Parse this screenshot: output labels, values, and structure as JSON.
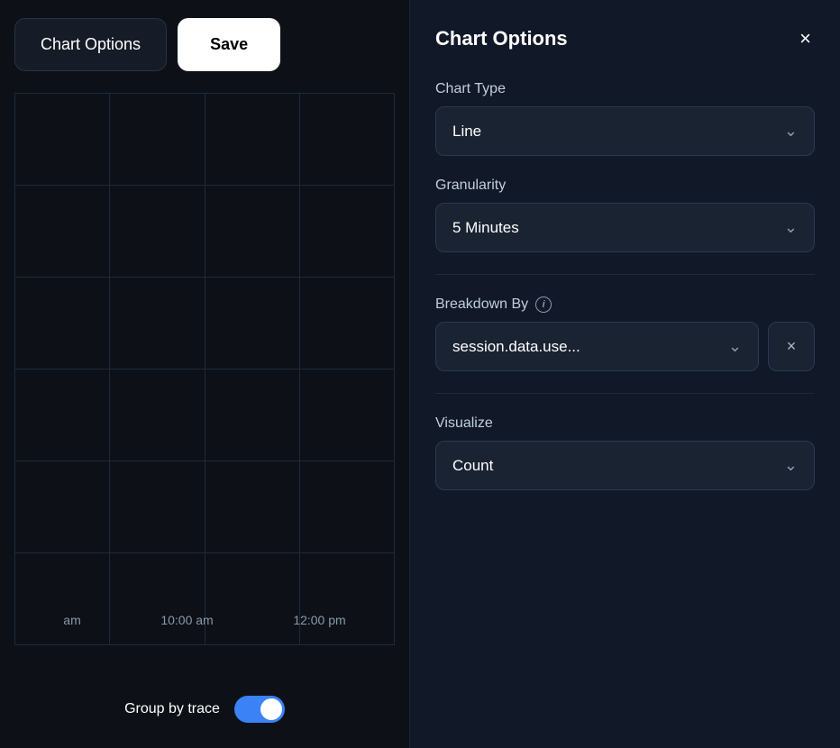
{
  "left": {
    "chart_options_btn": "Chart Options",
    "save_btn": "Save",
    "x_labels": [
      "am",
      "10:00 am",
      "12:00 pm"
    ],
    "group_by_label": "Group by trace",
    "grid_h_lines": 6,
    "grid_v_lines": 4
  },
  "right": {
    "title": "Chart Options",
    "close_icon": "×",
    "chart_type": {
      "label": "Chart Type",
      "value": "Line"
    },
    "granularity": {
      "label": "Granularity",
      "value": "5 Minutes"
    },
    "breakdown": {
      "label": "Breakdown By",
      "info": "i",
      "value": "session.data.use...",
      "clear": "×"
    },
    "visualize": {
      "label": "Visualize",
      "value": "Count"
    },
    "chevron": "⌄"
  }
}
